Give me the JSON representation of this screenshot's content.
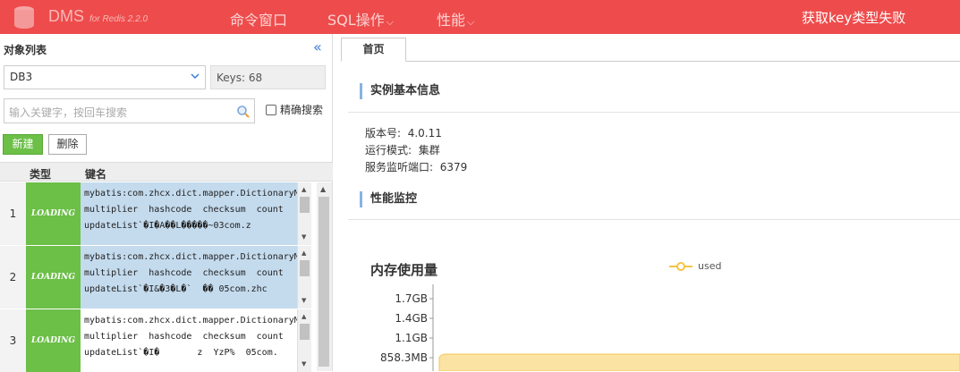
{
  "header": {
    "brand": "DMS",
    "brand_sub": "for Redis 2.2.0",
    "nav": [
      "命令窗口",
      "SQL操作",
      "性能"
    ],
    "error_message": "获取key类型失败",
    "colors": {
      "bar": "#ee4c4c"
    }
  },
  "left_panel": {
    "title": "对象列表",
    "collapse_icon": "double-chevron-left-icon",
    "db_select": "DB3",
    "keys_label": "Keys: 68",
    "search_placeholder": "输入关键字，按回车搜索",
    "exact_search_label": "精确搜索",
    "new_button": "新建",
    "delete_button": "删除",
    "columns": [
      "类型",
      "键名"
    ],
    "rows": [
      {
        "index": "1",
        "type": "LOADING",
        "key": "mybatis:com.zhcx.dict.mapper.DictionaryM\nmultiplier  hashcode  checksum  count\nupdateList`�I�A��L�����~03com.z"
      },
      {
        "index": "2",
        "type": "LOADING",
        "key": "mybatis:com.zhcx.dict.mapper.DictionaryM\nmultiplier  hashcode  checksum  count\nupdateList`�I&�3�L�`  �� 05com.zhc"
      },
      {
        "index": "3",
        "type": "LOADING",
        "key": "mybatis:com.zhcx.dict.mapper.DictionaryM\nmultiplier  hashcode  checksum  count\nupdateList`�I�       z  YzP%  05com."
      }
    ]
  },
  "right_panel": {
    "tab": "首页",
    "sections": {
      "basic_info": "实例基本信息",
      "performance": "性能监控"
    },
    "info": [
      {
        "label": "版本号:",
        "value": "4.0.11"
      },
      {
        "label": "运行模式:",
        "value": "集群"
      },
      {
        "label": "服务监听端口:",
        "value": "6379"
      }
    ]
  },
  "chart_data": {
    "type": "area",
    "title": "内存使用量",
    "series": [
      {
        "name": "used",
        "color": "#f5c542"
      }
    ],
    "y_tick_labels": [
      "1.7GB",
      "1.4GB",
      "1.1GB",
      "858.3MB"
    ]
  }
}
